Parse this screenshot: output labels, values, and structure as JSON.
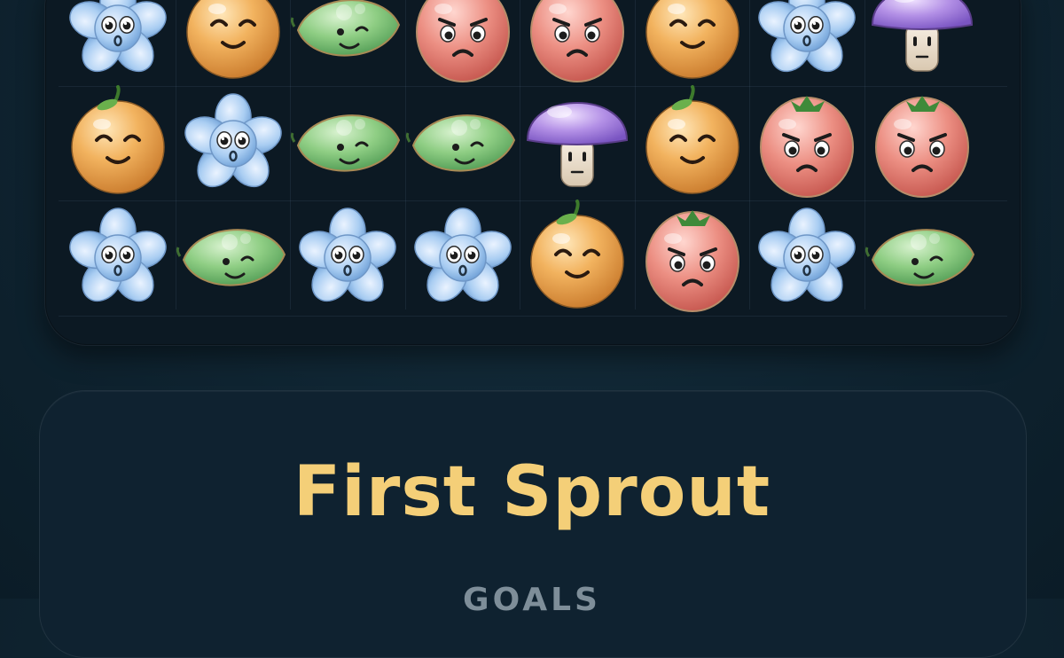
{
  "level": {
    "title": "First Sprout",
    "subtitle_partial": "GOALS"
  },
  "board": {
    "columns": 8,
    "visible_rows": 3,
    "cells": [
      [
        "flower",
        "orange",
        "leaf",
        "tomato",
        "tomato",
        "orange",
        "flower",
        "mushroom"
      ],
      [
        "orange",
        "flower",
        "leaf",
        "leaf",
        "mushroom",
        "orange",
        "tomato",
        "tomato"
      ],
      [
        "flower",
        "leaf",
        "flower",
        "flower",
        "orange",
        "tomato",
        "flower",
        "leaf"
      ]
    ]
  },
  "colors": {
    "background": "#0f2431",
    "board": "#0c1923",
    "title": "#f4cf78",
    "subtitle": "#7e8e99"
  }
}
